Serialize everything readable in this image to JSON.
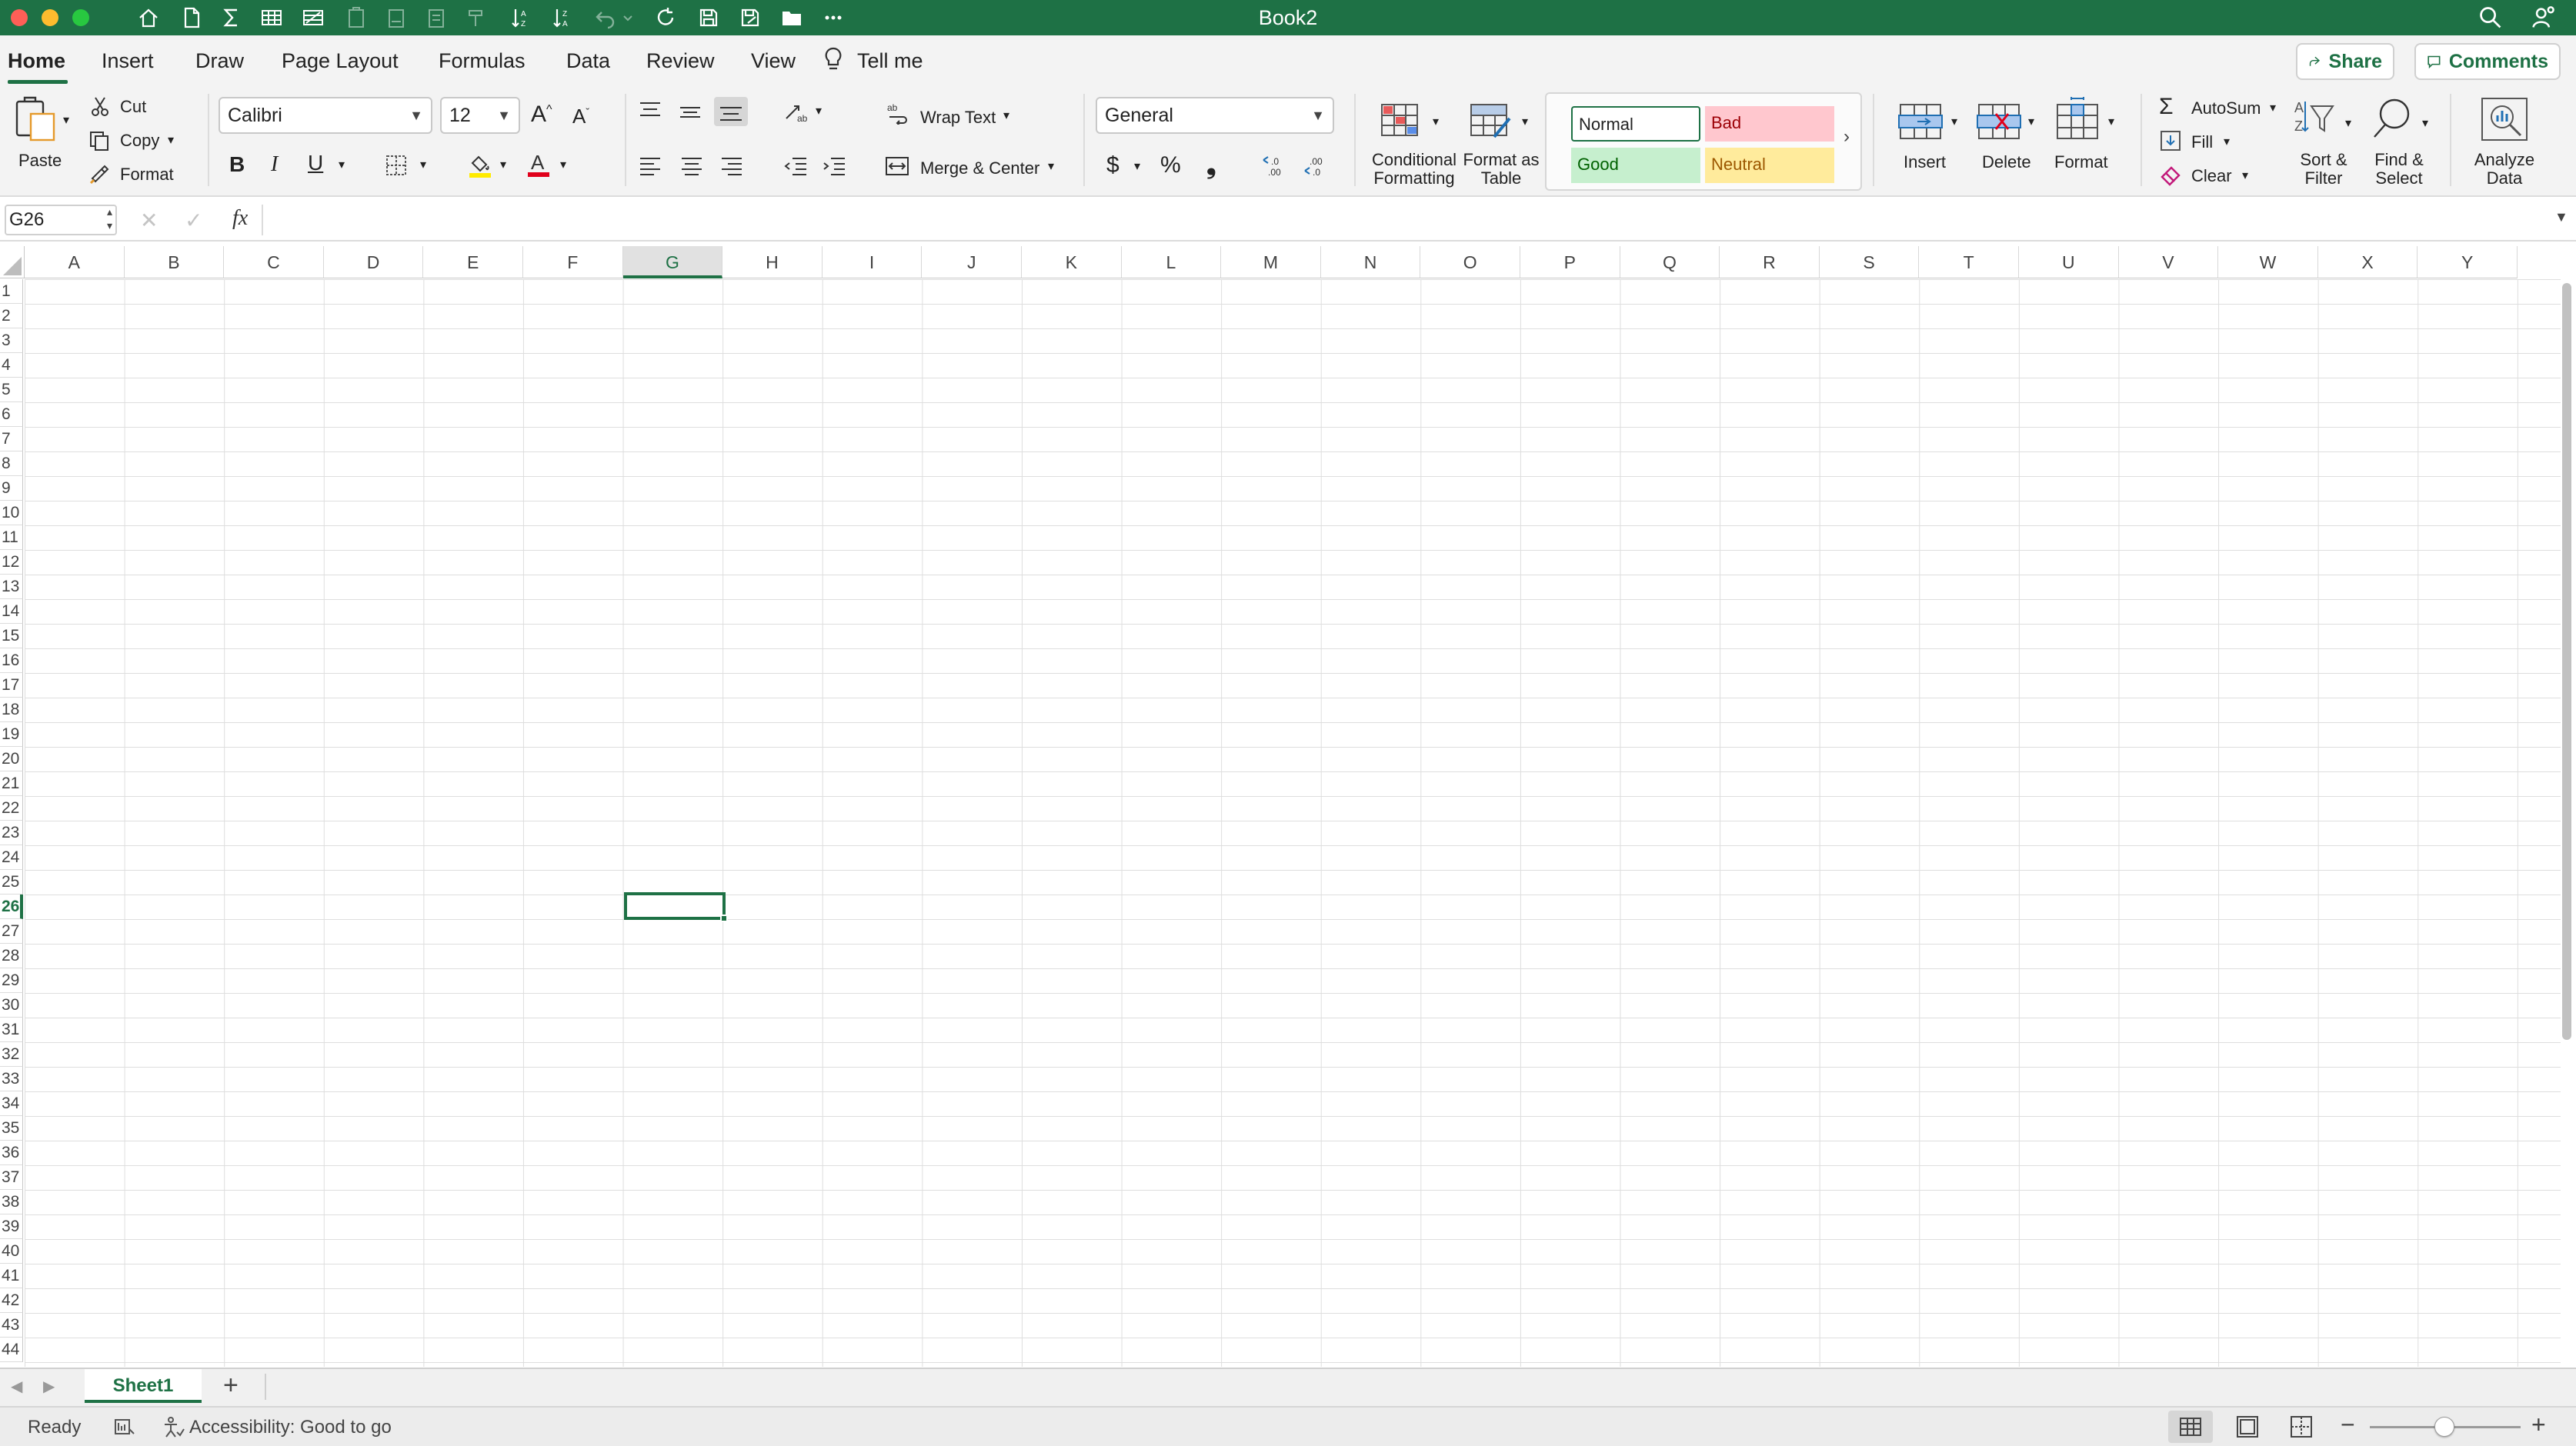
{
  "window": {
    "title": "Book2"
  },
  "ribbon_tabs": [
    "Home",
    "Insert",
    "Draw",
    "Page Layout",
    "Formulas",
    "Data",
    "Review",
    "View"
  ],
  "tell_me": "Tell me",
  "share": "Share",
  "comments": "Comments",
  "clipboard": {
    "paste": "Paste",
    "cut": "Cut",
    "copy": "Copy",
    "format": "Format"
  },
  "font": {
    "name": "Calibri",
    "size": "12"
  },
  "alignment": {
    "wrap_text": "Wrap Text",
    "merge_center": "Merge & Center"
  },
  "number": {
    "format": "General"
  },
  "styles": {
    "conditional_formatting": "Conditional Formatting",
    "format_as_table": "Format as Table",
    "normal": "Normal",
    "bad": "Bad",
    "good": "Good",
    "neutral": "Neutral"
  },
  "cells": {
    "insert": "Insert",
    "delete": "Delete",
    "format": "Format"
  },
  "editing": {
    "autosum": "AutoSum",
    "fill": "Fill",
    "clear": "Clear",
    "sort_filter": "Sort & Filter",
    "find_select": "Find & Select"
  },
  "analysis": {
    "analyze_data": "Analyze Data"
  },
  "formula_bar": {
    "name_box": "G26",
    "fx": "fx",
    "content": ""
  },
  "grid": {
    "columns": [
      "A",
      "B",
      "C",
      "D",
      "E",
      "F",
      "G",
      "H",
      "I",
      "J",
      "K",
      "L",
      "M",
      "N",
      "O",
      "P",
      "Q",
      "R",
      "S",
      "T",
      "U",
      "V",
      "W",
      "X",
      "Y"
    ],
    "rows": [
      "1",
      "2",
      "3",
      "4",
      "5",
      "6",
      "7",
      "8",
      "9",
      "10",
      "11",
      "12",
      "13",
      "14",
      "15",
      "16",
      "17",
      "18",
      "19",
      "20",
      "21",
      "22",
      "23",
      "24",
      "25",
      "26",
      "27",
      "28",
      "29",
      "30",
      "31",
      "32",
      "33",
      "34",
      "35",
      "36",
      "37",
      "38",
      "39",
      "40",
      "41",
      "42",
      "43",
      "44"
    ],
    "selected_column": "G",
    "selected_row": "26"
  },
  "sheets": {
    "tabs": [
      "Sheet1"
    ],
    "add": "+"
  },
  "status": {
    "ready": "Ready",
    "accessibility": "Accessibility: Good to go"
  },
  "colors": {
    "accent": "#1e7145",
    "bad_bg": "#ffc7ce",
    "bad_fg": "#9c0006",
    "good_bg": "#c6efce",
    "good_fg": "#006100",
    "neutral_bg": "#ffeb9c",
    "neutral_fg": "#9c5700"
  }
}
